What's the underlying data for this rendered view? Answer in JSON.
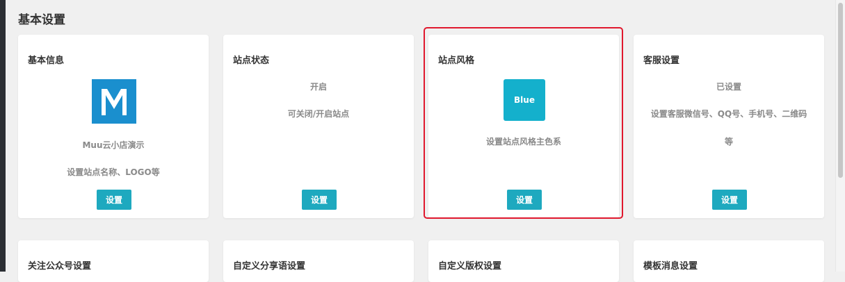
{
  "page": {
    "title": "基本设置"
  },
  "cards": [
    {
      "title": "基本信息",
      "logo_label": "M",
      "name": "Muu云小店演示",
      "desc": "设置站点名称、LOGO等",
      "button": "设置"
    },
    {
      "title": "站点状态",
      "status": "开启",
      "desc": "可关闭/开启站点",
      "button": "设置"
    },
    {
      "title": "站点风格",
      "tile_label": "Blue",
      "desc": "设置站点风格主色系",
      "button": "设置"
    },
    {
      "title": "客服设置",
      "status": "已设置",
      "desc_line1": "设置客服微信号、QQ号、手机号、二维码",
      "desc_line2": "等",
      "button": "设置"
    }
  ],
  "cards_row2": [
    {
      "title": "关注公众号设置"
    },
    {
      "title": "自定义分享语设置"
    },
    {
      "title": "自定义版权设置"
    },
    {
      "title": "模板消息设置"
    }
  ],
  "colors": {
    "accent": "#1ea9bf",
    "highlight": "#e0182d",
    "logo_blue": "#1a8fce",
    "tile_blue": "#14b0cc"
  }
}
